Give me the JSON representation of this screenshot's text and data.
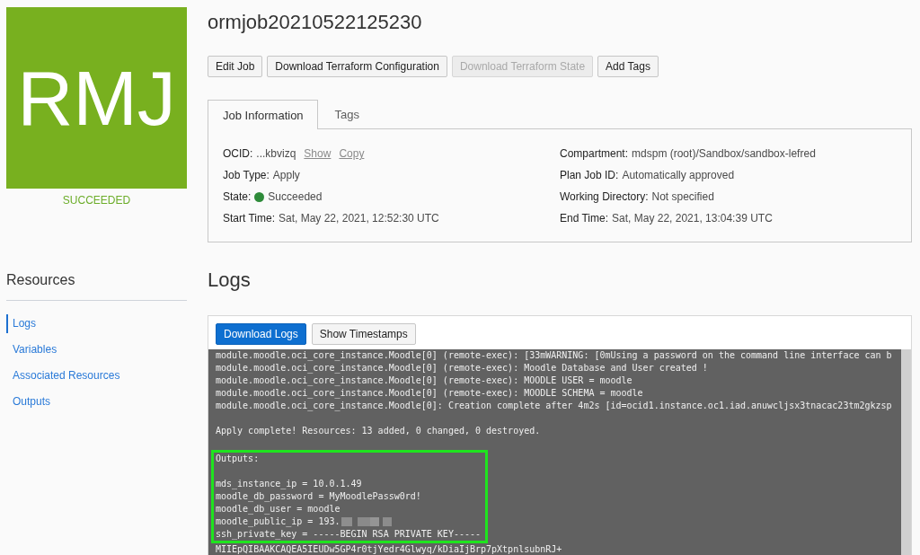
{
  "job": {
    "initials": "RMJ",
    "status": "SUCCEEDED",
    "title": "ormjob20210522125230"
  },
  "actions": [
    {
      "label": "Edit Job",
      "disabled": false
    },
    {
      "label": "Download Terraform Configuration",
      "disabled": false
    },
    {
      "label": "Download Terraform State",
      "disabled": true
    },
    {
      "label": "Add Tags",
      "disabled": false
    }
  ],
  "tabs": [
    {
      "label": "Job Information",
      "selected": true
    },
    {
      "label": "Tags",
      "selected": false
    }
  ],
  "job_information": {
    "left": [
      {
        "label": "OCID:",
        "value": "...kbvizq",
        "links": [
          "Show",
          "Copy"
        ]
      },
      {
        "label": "Job Type:",
        "value": "Apply"
      },
      {
        "label": "State:",
        "value": "Succeeded",
        "color": "#2e8b3a"
      },
      {
        "label": "Start Time:",
        "value": "Sat, May 22, 2021, 12:52:30 UTC"
      }
    ],
    "right": [
      {
        "label": "Compartment:",
        "value": "mdspm (root)/Sandbox/sandbox-lefred"
      },
      {
        "label": "Plan Job ID:",
        "value": "Automatically approved"
      },
      {
        "label": "Working Directory:",
        "value": "Not specified"
      },
      {
        "label": "End Time:",
        "value": "Sat, May 22, 2021, 13:04:39 UTC"
      }
    ]
  },
  "sidebar": {
    "title": "Resources",
    "items": [
      {
        "label": "Logs",
        "selected": true
      },
      {
        "label": "Variables",
        "selected": false
      },
      {
        "label": "Associated Resources",
        "selected": false
      },
      {
        "label": "Outputs",
        "selected": false
      }
    ]
  },
  "logs": {
    "title": "Logs",
    "buttons": [
      {
        "label": "Download Logs",
        "kind": "primary"
      },
      {
        "label": "Show Timestamps",
        "kind": "secondary"
      }
    ],
    "lines_before": [
      {
        "kind": "text",
        "text": "module.moodle.oci_core_instance.Moodle[0] (remote-exec): [33mWARNING: [0mUsing a password on the command line interface can b"
      },
      {
        "kind": "text",
        "text": "module.moodle.oci_core_instance.Moodle[0] (remote-exec): Moodle Database and User created !"
      },
      {
        "kind": "text",
        "text": "module.moodle.oci_core_instance.Moodle[0] (remote-exec): MOODLE USER = moodle"
      },
      {
        "kind": "text",
        "text": "module.moodle.oci_core_instance.Moodle[0] (remote-exec): MOODLE SCHEMA = moodle"
      },
      {
        "kind": "text",
        "text": "module.moodle.oci_core_instance.Moodle[0]: Creation complete after 4m2s [id=ocid1.instance.oc1.iad.anuwcljsx3tnacac23tm2gkzsp"
      },
      {
        "kind": "blank"
      },
      {
        "kind": "text",
        "text": "Apply complete! Resources: 13 added, 0 changed, 0 destroyed."
      },
      {
        "kind": "blank"
      }
    ],
    "highlighted_lines": [
      {
        "kind": "text",
        "text": "Outputs:"
      },
      {
        "kind": "blank"
      },
      {
        "kind": "text",
        "text": "mds_instance_ip = 10.0.1.49"
      },
      {
        "kind": "text",
        "text": "moodle_db_password = MyMoodlePassw0rd!"
      },
      {
        "kind": "text",
        "text": "moodle_db_user = moodle"
      },
      {
        "kind": "redacted",
        "text": "moodle_public_ip = 193."
      },
      {
        "kind": "text",
        "text": "ssh_private_key = -----BEGIN RSA PRIVATE KEY-----"
      }
    ],
    "lines_after": [
      {
        "kind": "text",
        "text": "MIIEpQIBAAKCAQEA5IEUDw5GP4r0tjYedr4Glwyq/kDiaIjBrp7pXtpnlsubnRJ+"
      }
    ]
  }
}
